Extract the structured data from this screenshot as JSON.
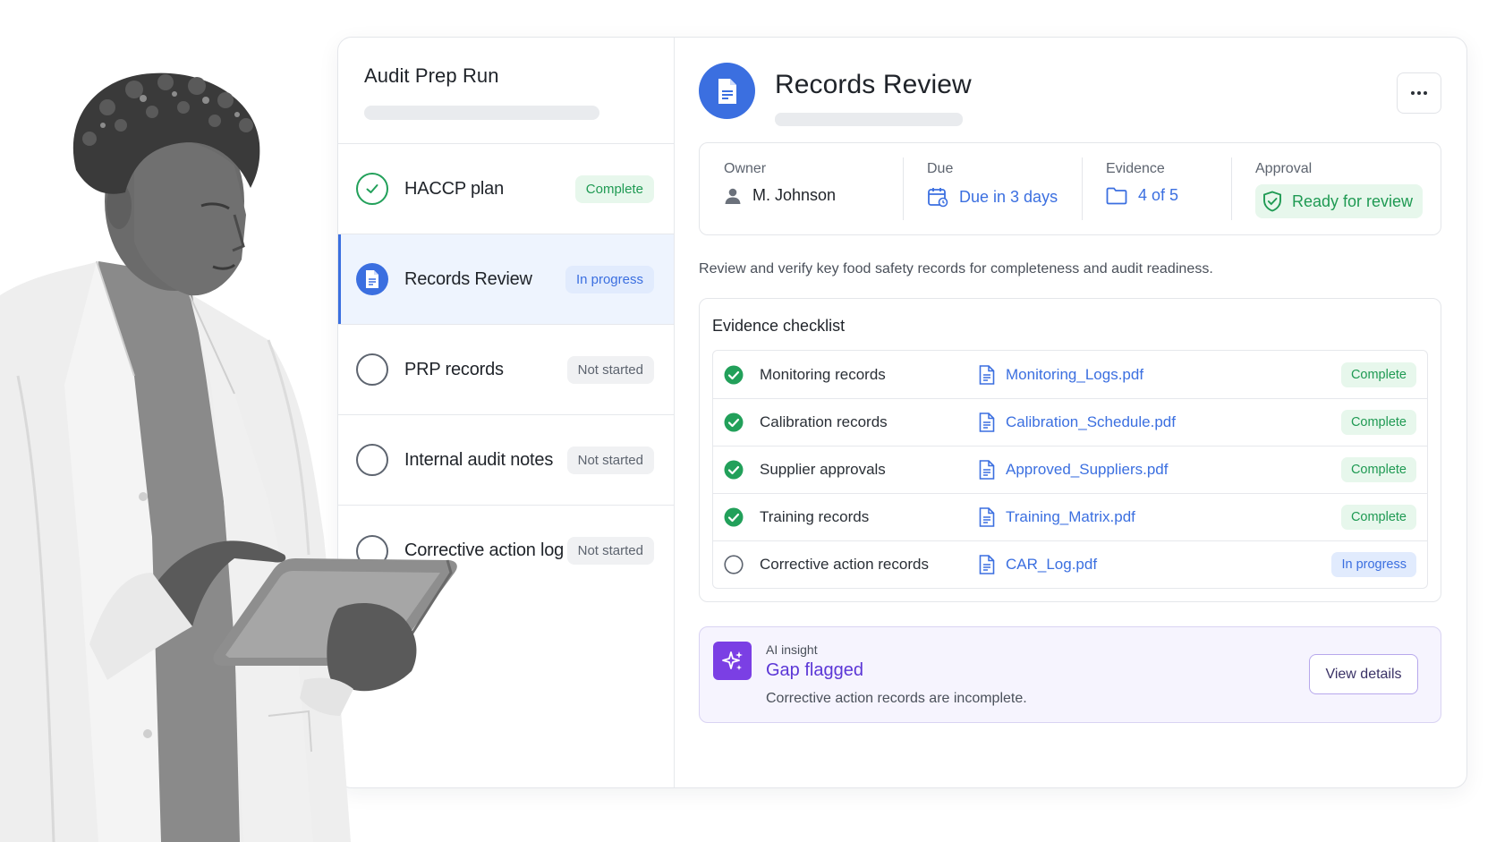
{
  "run": {
    "title": "Audit Prep Run",
    "steps": [
      {
        "label": "HACCP plan",
        "status": "Complete",
        "state": "done"
      },
      {
        "label": "Records Review",
        "status": "In progress",
        "state": "current"
      },
      {
        "label": "PRP records",
        "status": "Not started",
        "state": "todo"
      },
      {
        "label": "Internal audit notes",
        "status": "Not started",
        "state": "todo"
      },
      {
        "label": "Corrective action log",
        "status": "Not started",
        "state": "todo"
      }
    ]
  },
  "review": {
    "title": "Records Review",
    "header_icon": "document-icon",
    "more_icon": "more-horizontal-icon",
    "meta": {
      "owner": {
        "label": "Owner",
        "value": "M. Johnson",
        "icon": "user-icon"
      },
      "due": {
        "label": "Due",
        "value": "Due in 3 days",
        "icon": "calendar-icon"
      },
      "evidence": {
        "label": "Evidence",
        "value": "4 of 5",
        "icon": "folder-icon"
      },
      "approval": {
        "label": "Approval",
        "value": "Ready for review",
        "icon": "shield-check-icon"
      }
    },
    "description": "Review and verify key food safety records for completeness and audit readiness."
  },
  "checklist": {
    "title": "Evidence checklist",
    "rows": [
      {
        "name": "Monitoring records",
        "file": "Monitoring_Logs.pdf",
        "status": "Complete",
        "done": true
      },
      {
        "name": "Calibration records",
        "file": "Calibration_Schedule.pdf",
        "status": "Complete",
        "done": true
      },
      {
        "name": "Supplier approvals",
        "file": "Approved_Suppliers.pdf",
        "status": "Complete",
        "done": true
      },
      {
        "name": "Training records",
        "file": "Training_Matrix.pdf",
        "status": "Complete",
        "done": true
      },
      {
        "name": "Corrective action records",
        "file": "CAR_Log.pdf",
        "status": "In progress",
        "done": false
      }
    ]
  },
  "insight": {
    "label": "AI insight",
    "title": "Gap flagged",
    "description": "Corrective action records are incomplete.",
    "button": "View details",
    "icon": "sparkle-icon"
  },
  "colors": {
    "primary": "#3b6fe0",
    "success": "#22a05a",
    "ai_accent": "#7b3fe4"
  }
}
